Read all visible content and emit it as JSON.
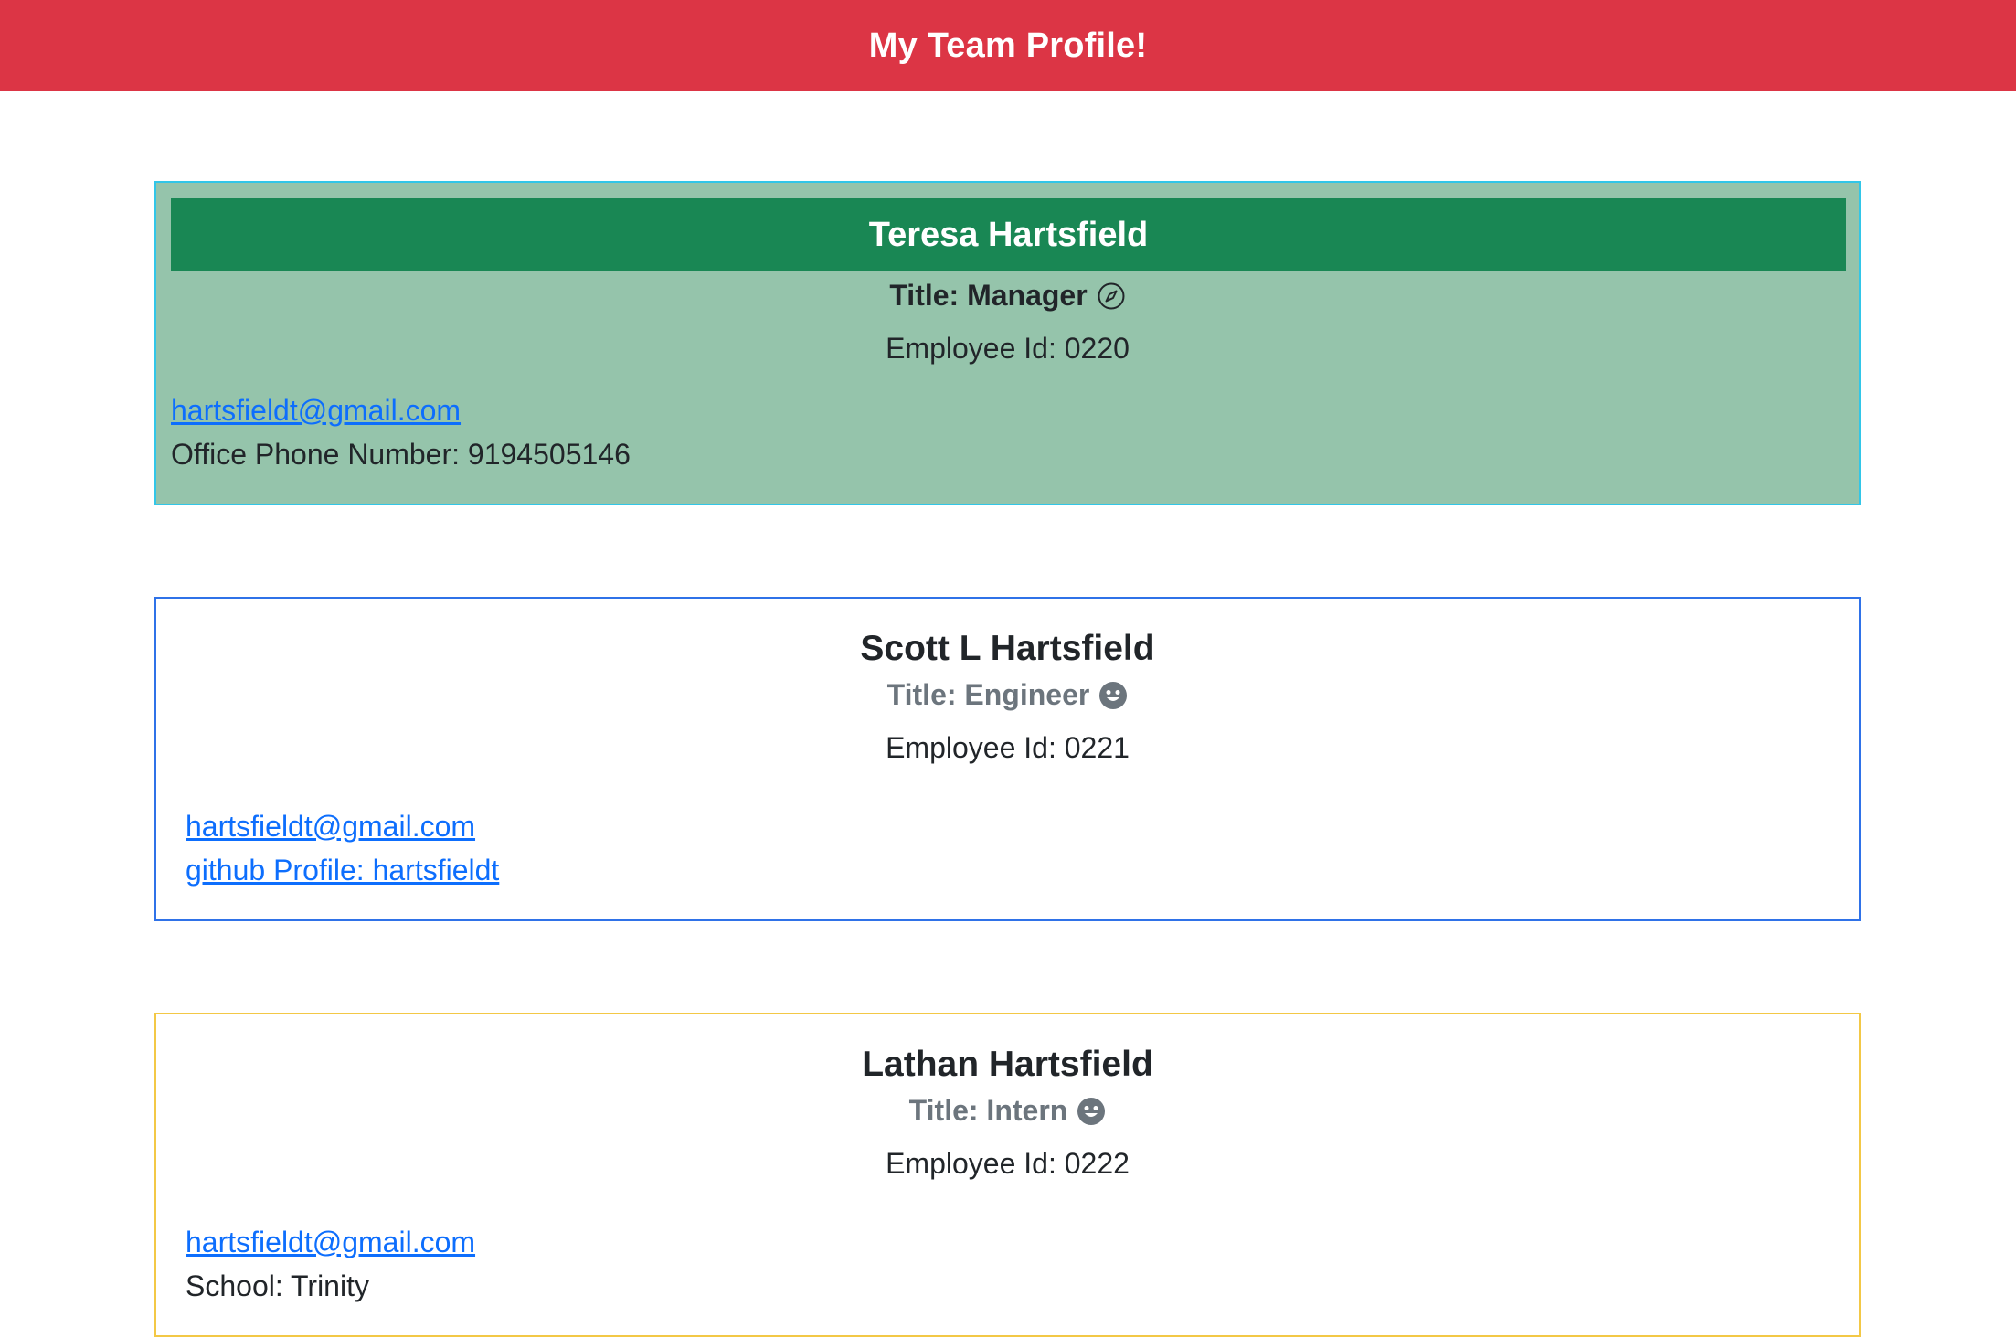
{
  "header": {
    "title": "My Team Profile!"
  },
  "colors": {
    "header_bg": "#dc3545",
    "manager_card_bg": "#95c4ab",
    "manager_header_bg": "#198754",
    "manager_border": "#32c6e8",
    "engineer_border": "#2f72e8",
    "intern_border": "#f3c846",
    "link": "#0d6efd",
    "muted_text": "#6c757d"
  },
  "manager": {
    "name": "Teresa Hartsfield",
    "title": "Title: Manager",
    "title_icon": "compass-icon",
    "employee_id": "Employee Id: 0220",
    "email": "hartsfieldt@gmail.com",
    "office_phone": "Office Phone Number: 9194505146"
  },
  "engineer": {
    "name": "Scott L Hartsfield",
    "title": "Title: Engineer",
    "title_icon": "smiley-icon",
    "employee_id": "Employee Id: 0221",
    "email": "hartsfieldt@gmail.com",
    "github": "github Profile: hartsfieldt"
  },
  "intern": {
    "name": "Lathan Hartsfield",
    "title": "Title: Intern",
    "title_icon": "smiley-icon",
    "employee_id": "Employee Id: 0222",
    "email": "hartsfieldt@gmail.com",
    "school": "School: Trinity"
  }
}
